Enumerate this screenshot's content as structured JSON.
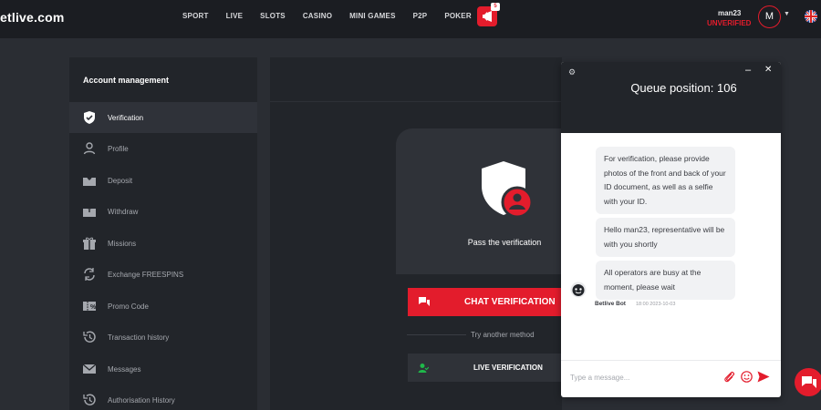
{
  "header": {
    "logo_text": "etlive.com",
    "nav": [
      "SPORT",
      "LIVE",
      "SLOTS",
      "CASINO",
      "MINI GAMES",
      "P2P",
      "POKER"
    ],
    "promo_badge": "5",
    "username": "man23",
    "status": "UNVERIFIED",
    "avatar_letter": "M"
  },
  "sidebar": {
    "title": "Account management",
    "items": [
      {
        "label": "Verification",
        "icon": "shield-check-icon"
      },
      {
        "label": "Profile",
        "icon": "user-icon"
      },
      {
        "label": "Deposit",
        "icon": "wallet-in-icon"
      },
      {
        "label": "Withdraw",
        "icon": "wallet-out-icon"
      },
      {
        "label": "Missions",
        "icon": "gift-icon"
      },
      {
        "label": "Exchange FREESPINS",
        "icon": "exchange-icon"
      },
      {
        "label": "Promo Code",
        "icon": "promo-code-icon"
      },
      {
        "label": "Transaction history",
        "icon": "history-icon"
      },
      {
        "label": "Messages",
        "icon": "envelope-icon"
      },
      {
        "label": "Authorisation History",
        "icon": "history-icon"
      }
    ]
  },
  "main": {
    "pass_text": "Pass the verification",
    "chat_button": "CHAT VERIFICATION",
    "try_text": "Try another method",
    "live_button": "LIVE VERIFICATION"
  },
  "chat": {
    "queue": "Queue position: 106",
    "messages": [
      "For verification, please provide photos of the front and back of your ID document, as well as a selfie with your ID.",
      "Hello man23, representative will be with you shortly",
      "All operators are busy at the moment, please wait"
    ],
    "bot_name": "Betlive Bot",
    "timestamp": "18:00 2023-10-03",
    "input_placeholder": "Type a message..."
  },
  "colors": {
    "accent": "#e31c2c",
    "background": "#2a2d33",
    "panel": "#22252a",
    "live_icon": "#1fb84a"
  }
}
